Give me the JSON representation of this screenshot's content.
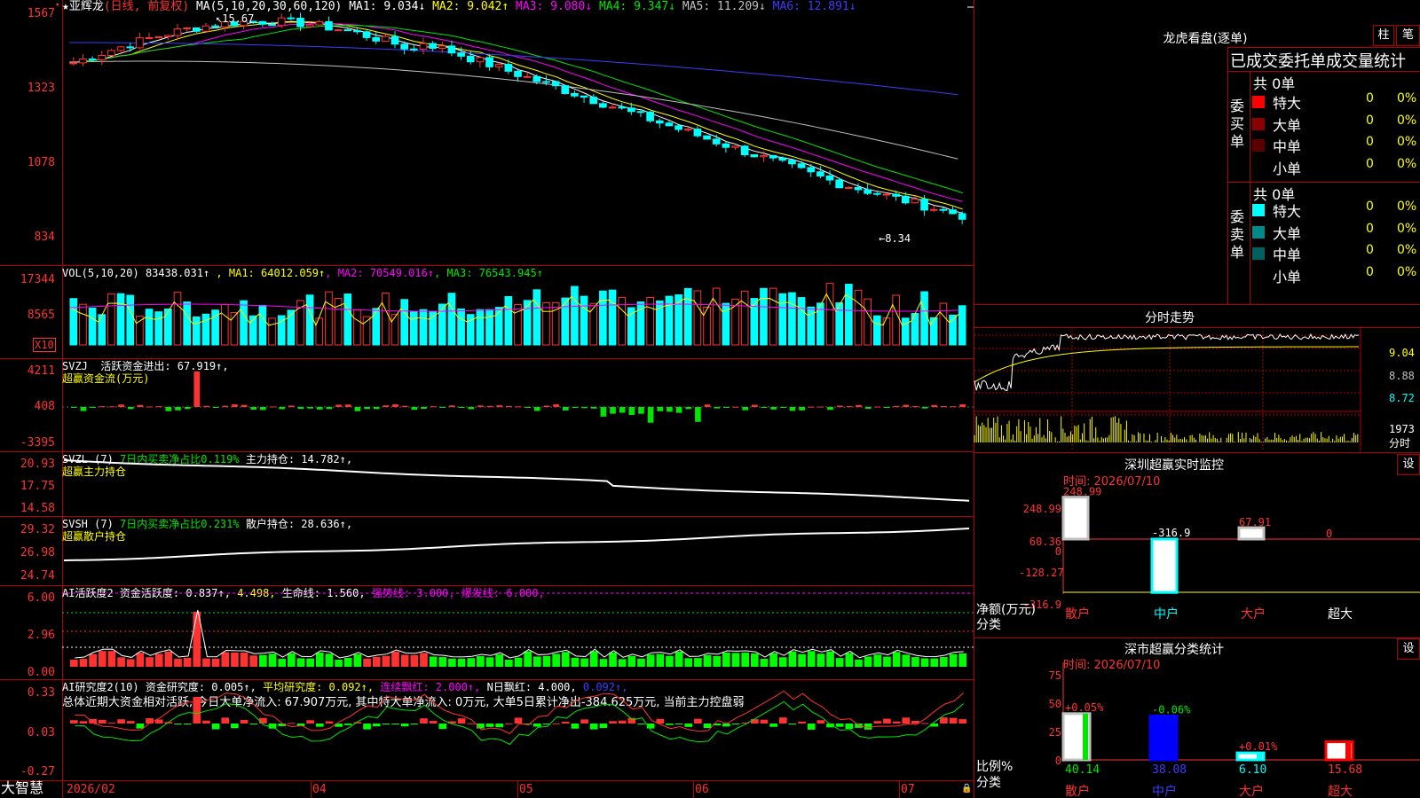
{
  "kline": {
    "stock_name": "亚辉龙",
    "period": "(日线, 前复权)",
    "ma_label": "MA(5,10,20,30,60,120)",
    "ma": [
      {
        "name": "MA1:",
        "value": "9.034",
        "arrow": "↓",
        "color": "#ffffff"
      },
      {
        "name": "MA2:",
        "value": "9.042",
        "arrow": "↑",
        "color": "#ffff00"
      },
      {
        "name": "MA3:",
        "value": "9.080",
        "arrow": "↓",
        "color": "#ff00ff"
      },
      {
        "name": "MA4:",
        "value": "9.347",
        "arrow": "↓",
        "color": "#00e600"
      },
      {
        "name": "MA5:",
        "value": "11.209",
        "arrow": "↓",
        "color": "#c0c0c0"
      },
      {
        "name": "MA6:",
        "value": "12.891",
        "arrow": "↓",
        "color": "#3c3cff"
      }
    ],
    "y_ticks": [
      "1567",
      "1323",
      "1078",
      "834"
    ],
    "high_label": "15.67",
    "low_label": "←8.34"
  },
  "vol": {
    "label": "VOL(5,10,20)",
    "value": "83438.031↑",
    "ma": [
      {
        "name": "MA1:",
        "value": "64012.059↑",
        "color": "#ffff00"
      },
      {
        "name": "MA2:",
        "value": "70549.016↑",
        "color": "#ff00ff"
      },
      {
        "name": "MA3:",
        "value": "76543.945↑",
        "color": "#00e600"
      }
    ],
    "y_ticks": [
      "17344",
      "8565"
    ],
    "unit": "X10"
  },
  "svzj": {
    "label": "SVZJ",
    "text": "活跃资金进出: 67.919↑,",
    "sub": "超赢资金流(万元)",
    "y_ticks": [
      "4211",
      "408",
      "-3395"
    ]
  },
  "svzl": {
    "label": "SVZL (7)",
    "text1": "7日内买卖净占比0.119%",
    "text2": "主力持仓: 14.782↑,",
    "sub": "超赢主力持仓",
    "y_ticks": [
      "20.93",
      "17.75",
      "14.58"
    ]
  },
  "svsh": {
    "label": "SVSH (7)",
    "text1": "7日内买卖净占比0.231%",
    "text2": "散户持仓: 28.636↑,",
    "sub": "超赢散户持仓",
    "y_ticks": [
      "29.32",
      "26.98",
      "24.74"
    ]
  },
  "ai_active": {
    "label": "AI活跃度2",
    "text1": "资金活跃度: 0.837↑,",
    "text2": "4.498,",
    "text3": "生命线: 1.560,",
    "text4": "强势线: 3.000,",
    "text5": "爆发线: 6.000,",
    "y_ticks": [
      "6.00",
      "2.96",
      "0.00"
    ]
  },
  "ai_research": {
    "label": "AI研究度2(10)",
    "text1": "资金研究度: 0.005↑,",
    "text2": "平均研究度: 0.092↑,",
    "text3": "连续飘红: 2.000↑,",
    "text4": "N日飘红: 4.000,",
    "text5": "0.092↑,",
    "summary": "总体近期大资金相对活跃, 今日大单净流入: 67.907万元, 其中特大单净流入: 0万元, 大单5日累计净出-384.625万元, 当前主力控盘弱",
    "y_ticks": [
      "0.33",
      "0.03",
      "-0.27"
    ]
  },
  "x_axis": {
    "labels": [
      "2026/02",
      "04",
      "05",
      "06",
      "07"
    ]
  },
  "brand": "大智慧",
  "right_panel": {
    "lhkp_title": "龙虎看盘(逐单)",
    "btn_zhu": "柱",
    "btn_bi": "笔",
    "order_title": "已成交委托单成交量统计",
    "buy_side_label": "委买单",
    "sell_side_label": "委卖单",
    "buy_total": "共 0单",
    "sell_total": "共 0单",
    "buy_rows": [
      {
        "name": "特大",
        "qty": "0",
        "pct": "0%",
        "color": "#ff0000"
      },
      {
        "name": "大单",
        "qty": "0",
        "pct": "0%",
        "color": "#8b0000"
      },
      {
        "name": "中单",
        "qty": "0",
        "pct": "0%",
        "color": "#5a0000"
      },
      {
        "name": "小单",
        "qty": "0",
        "pct": "0%",
        "color": "#000000"
      }
    ],
    "sell_rows": [
      {
        "name": "特大",
        "qty": "0",
        "pct": "0%",
        "color": "#00ffff"
      },
      {
        "name": "大单",
        "qty": "0",
        "pct": "0%",
        "color": "#008b8b"
      },
      {
        "name": "中单",
        "qty": "0",
        "pct": "0%",
        "color": "#006060"
      },
      {
        "name": "小单",
        "qty": "0",
        "pct": "0%",
        "color": "#000000"
      }
    ],
    "fenshi_title": "分时走势",
    "fenshi_ticks": [
      "9.04",
      "8.88",
      "8.72"
    ],
    "fenshi_vol_tick": "1973",
    "fenshi_vol_label": "分时",
    "sz_monitor_title": "深圳超赢实时监控",
    "settings_btn": "设",
    "monitor_time": "时间: 2026/07/10",
    "monitor_y_ticks": [
      "248.99",
      "60.36",
      "0",
      "-128.27",
      "-316.9"
    ],
    "monitor_axis_label": "净额(万元)",
    "monitor_axis_label2": "分类",
    "monitor_chart": {
      "categories": [
        "散户",
        "中户",
        "大户",
        "超大"
      ],
      "values": [
        248.99,
        -316.9,
        67.91,
        0
      ],
      "value_labels": [
        "248.99",
        "-316.9",
        "67.91",
        "0"
      ]
    },
    "sz_class_title": "深市超赢分类统计",
    "class_time": "时间: 2026/07/10",
    "class_y_ticks": [
      "75",
      "50",
      "25",
      "0"
    ],
    "class_axis_label": "比例%",
    "class_axis_label2": "分类",
    "class_chart": {
      "categories": [
        "散户",
        "中户",
        "大户",
        "超大"
      ],
      "values": [
        40.14,
        38.08,
        6.1,
        15.68
      ],
      "value_labels": [
        "40.14",
        "38.08",
        "6.10",
        "15.68"
      ],
      "change_labels": [
        "+0.05%",
        "-0.06%",
        "+0.01%",
        ""
      ]
    }
  }
}
